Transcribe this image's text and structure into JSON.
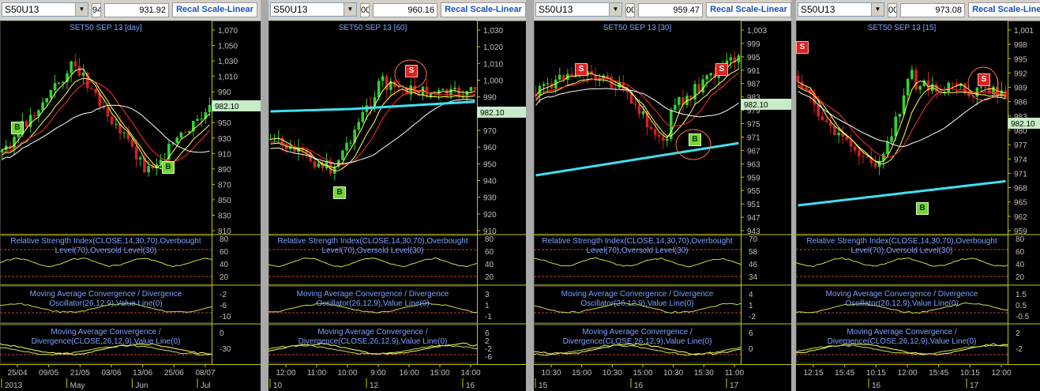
{
  "panels": [
    {
      "symbol": "S50U13",
      "fragment": "94",
      "price_display": "931.92",
      "recal_label": "Recal Scale-Linear",
      "title_prefix": "SET50 SEP 13",
      "title_interval": "[day]",
      "last_price": "982.10",
      "y_ticks": [
        "1,070",
        "1,050",
        "1,030",
        "1,010",
        "990",
        "970",
        "950",
        "930",
        "910",
        "890",
        "870",
        "850",
        "830",
        "810"
      ],
      "rsi_label_1": "Relative Strength Index(CLOSE,14,30,70),Overbought",
      "rsi_label_2": "Level(70),Oversold Level(30)",
      "rsi_ticks": [
        "80",
        "60",
        "40",
        "20"
      ],
      "macd_label_1": "Moving Average Convergence / Divergence",
      "macd_label_2": "Oscillator(26,12,9),Value Line(0)",
      "macd_ticks": [
        "-2",
        "-6",
        "-10"
      ],
      "macd2_label_1": "Moving Average Convergence /",
      "macd2_label_2": "Divergence(CLOSE,26,12,9),Value Line(0)",
      "macd2_ticks": [
        "0",
        "-30"
      ],
      "x_labels": [
        "25/04",
        "09/05",
        "21/05",
        "03/06",
        "13/06",
        "25/06",
        "08/07"
      ],
      "x_labels2": [
        "2013",
        "May",
        "Jun",
        "Jul"
      ],
      "signals": [
        {
          "type": "B",
          "label": "B"
        },
        {
          "type": "B",
          "label": "B"
        }
      ]
    },
    {
      "symbol": "S50U13",
      "fragment": "00",
      "price_display": "960.16",
      "recal_label": "Recal Scale-Linear",
      "title_prefix": "SET50 SEP 13",
      "title_interval": "[60]",
      "last_price": "982.10",
      "y_ticks": [
        "1,030",
        "1,020",
        "1,010",
        "1,000",
        "990",
        "980",
        "970",
        "960",
        "950",
        "940",
        "930",
        "920",
        "910"
      ],
      "rsi_label_1": "Relative Strength Index(CLOSE,14,30,70),Overbought",
      "rsi_label_2": "Level(70),Oversold Level(30)",
      "rsi_ticks": [
        "80",
        "60",
        "40",
        "20"
      ],
      "macd_label_1": "Moving Average Convergence / Divergence",
      "macd_label_2": "Oscillator(26,12,9),Value Line(0)",
      "macd_ticks": [
        "3",
        "1",
        "-1"
      ],
      "macd2_label_1": "Moving Average Convergence /",
      "macd2_label_2": "Divergence(CLOSE,26,12,9),Value Line(0)",
      "macd2_ticks": [
        "6",
        "2",
        "-2",
        "-6"
      ],
      "x_labels": [
        "12:00",
        "11:00",
        "10:00",
        "9:00",
        "16:00",
        "15:00",
        "14:00"
      ],
      "x_labels2": [
        "10",
        "12",
        "16"
      ],
      "signals": [
        {
          "type": "S",
          "label": "S"
        },
        {
          "type": "B",
          "label": "B"
        }
      ]
    },
    {
      "symbol": "S50U13",
      "fragment": "00",
      "price_display": "959.47",
      "recal_label": "Recal Scale-Linear",
      "title_prefix": "SET50 SEP 13",
      "title_interval": "[30]",
      "last_price": "982.10",
      "y_ticks": [
        "1,003",
        "999",
        "995",
        "991",
        "987",
        "983",
        "979",
        "975",
        "971",
        "967",
        "963",
        "959",
        "955",
        "951",
        "947",
        "943"
      ],
      "rsi_label_1": "Relative Strength Index(CLOSE,14,30,70),Overbought",
      "rsi_label_2": "Level(70),Oversold Level(30)",
      "rsi_ticks": [
        "70",
        "58",
        "46",
        "34"
      ],
      "macd_label_1": "Moving Average Convergence / Divergence",
      "macd_label_2": "Oscillator(26,12,9),Value Line(0)",
      "macd_ticks": [
        "4",
        "1",
        "-2"
      ],
      "macd2_label_1": "Moving Average Convergence /",
      "macd2_label_2": "Divergence(CLOSE,26,12,9),Value Line(0)",
      "macd2_ticks": [
        "6",
        "0"
      ],
      "x_labels": [
        "10:30",
        "15:00",
        "10:30",
        "15:00",
        "10:30",
        "15:30",
        "11:00"
      ],
      "x_labels2": [
        "15",
        "16",
        "17"
      ],
      "signals": [
        {
          "type": "S",
          "label": "S"
        },
        {
          "type": "S",
          "label": "S"
        },
        {
          "type": "B",
          "label": "B"
        }
      ]
    },
    {
      "symbol": "S50U13",
      "fragment": "00",
      "price_display": "973.08",
      "recal_label": "Recal Scale-Linear",
      "title_prefix": "SET50 SEP 13",
      "title_interval": "[15]",
      "last_price": "982.10",
      "y_ticks": [
        "1,001",
        "998",
        "995",
        "992",
        "989",
        "986",
        "983",
        "980",
        "977",
        "974",
        "971",
        "968",
        "965",
        "962",
        "959"
      ],
      "rsi_label_1": "Relative Strength Index(CLOSE,14,30,70),Overbought",
      "rsi_label_2": "Level(70),Oversold Level(30)",
      "rsi_ticks": [
        "80",
        "60",
        "40",
        "20"
      ],
      "macd_label_1": "Moving Average Convergence / Divergence",
      "macd_label_2": "Oscillator(26,12,9),Value Line(0)",
      "macd_ticks": [
        "1.5",
        "0.5",
        "-0.5"
      ],
      "macd2_label_1": "Moving Average Convergence /",
      "macd2_label_2": "Divergence(CLOSE,26,12,9),Value Line(0)",
      "macd2_ticks": [
        "2",
        "-2"
      ],
      "x_labels": [
        "12:15",
        "15:45",
        "10:15",
        "12:00",
        "15:45",
        "10:15",
        "12:00"
      ],
      "x_labels2": [
        "16",
        "17"
      ],
      "signals": [
        {
          "type": "S",
          "label": "S"
        },
        {
          "type": "S",
          "label": "S"
        },
        {
          "type": "B",
          "label": "B"
        }
      ]
    }
  ],
  "colors": {
    "candle_up": "#2fd42f",
    "candle_down": "#d42020",
    "ma_fast": "#ffff60",
    "ma_mid": "#ff3030",
    "ma_slow": "#ffffff",
    "ma_long": "#40e0f0",
    "indicator": "#c8e040",
    "label_text": "#7ea1ff",
    "last_price_bg": "#c8ecc8"
  }
}
